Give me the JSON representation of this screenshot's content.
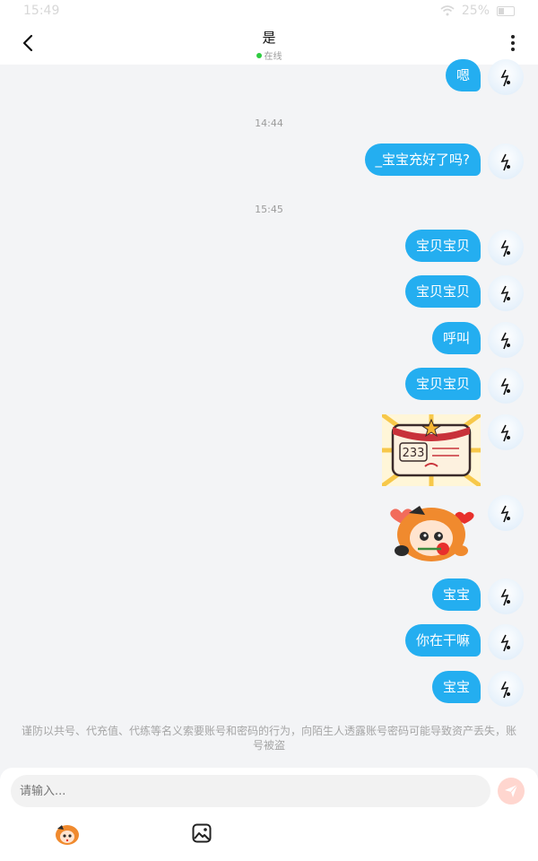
{
  "status_bar": {
    "time": "15:49",
    "battery": "25%"
  },
  "header": {
    "title": "是",
    "status": "在线"
  },
  "timestamps": [
    "14:44",
    "15:45"
  ],
  "messages": [
    {
      "type": "text",
      "text": "嗯"
    },
    {
      "type": "text",
      "text": "_宝宝充好了吗?"
    },
    {
      "type": "text",
      "text": "宝贝宝贝"
    },
    {
      "type": "text",
      "text": "宝贝宝贝"
    },
    {
      "type": "text",
      "text": "呼叫"
    },
    {
      "type": "text",
      "text": "宝贝宝贝"
    },
    {
      "type": "sticker",
      "name": "certificate-233-sticker",
      "label": "233"
    },
    {
      "type": "sticker",
      "name": "girl-rose-sticker"
    },
    {
      "type": "text",
      "text": "宝宝"
    },
    {
      "type": "text",
      "text": "你在干嘛"
    },
    {
      "type": "text",
      "text": "宝宝"
    }
  ],
  "warning": "谨防以共号、代充值、代练等名义索要账号和密码的行为，向陌生人透露账号密码可能导致资产丢失，账号被盗",
  "composer": {
    "placeholder": "请输入..."
  },
  "colors": {
    "bubble": "#24aef0",
    "online": "#2ecc40",
    "send": "#ffd6cf"
  }
}
